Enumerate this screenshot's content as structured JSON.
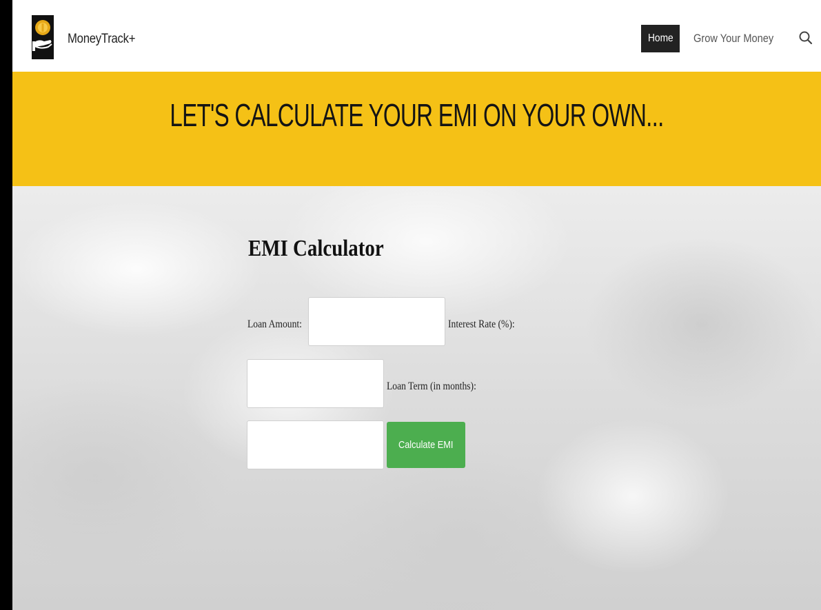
{
  "header": {
    "brand": "MoneyTrack+",
    "nav": {
      "home": "Home",
      "grow": "Grow Your Money"
    },
    "search_icon": "search-icon",
    "logo_icon": "coin-hand-icon"
  },
  "banner": {
    "title": "LET'S CALCULATE YOUR EMI ON YOUR OWN...",
    "color": "#f5c116"
  },
  "calculator": {
    "title": "EMI Calculator",
    "loan_amount_label": "Loan Amount:",
    "loan_amount_value": "",
    "interest_rate_label": "Interest Rate (%):",
    "interest_rate_value": "",
    "loan_term_label": "Loan Term (in months):",
    "loan_term_value": "",
    "button_label": "Calculate EMI",
    "button_color": "#4cae4f"
  }
}
